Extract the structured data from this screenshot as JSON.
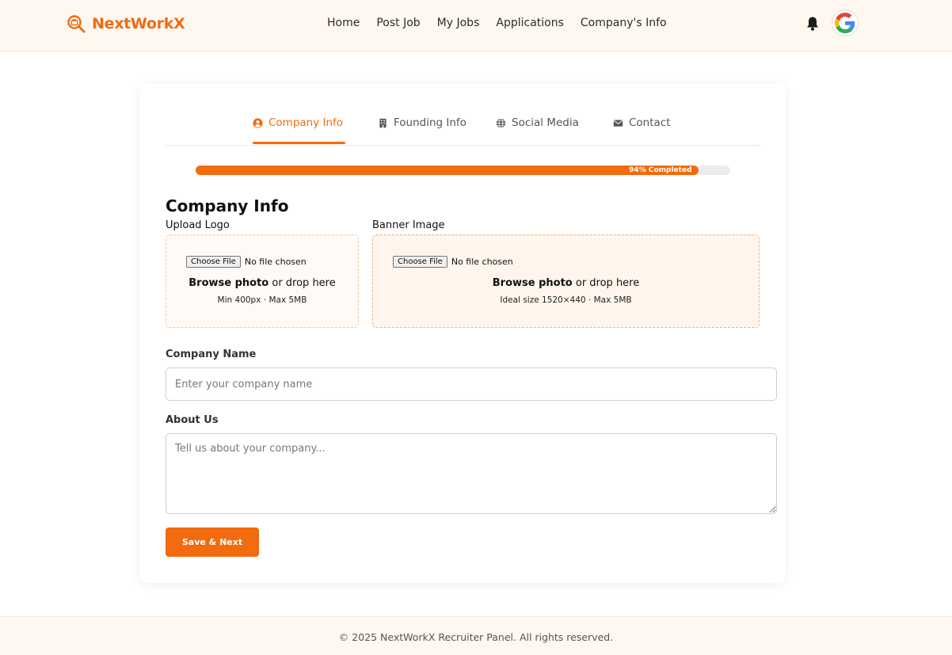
{
  "brand": {
    "name": "NextWorkX",
    "accent": "#f26b0f",
    "icon": "search-briefcase-icon"
  },
  "nav": {
    "items": [
      "Home",
      "Post Job",
      "My Jobs",
      "Applications",
      "Company's Info"
    ]
  },
  "header": {
    "bell_icon": "bell-icon",
    "avatar_icon": "google-g-icon"
  },
  "tabs": [
    {
      "label": "Company Info",
      "icon": "user-circle-icon",
      "active": true
    },
    {
      "label": "Founding Info",
      "icon": "building-icon",
      "active": false
    },
    {
      "label": "Social Media",
      "icon": "globe-icon",
      "active": false
    },
    {
      "label": "Contact",
      "icon": "envelope-icon",
      "active": false
    }
  ],
  "progress": {
    "percent": 94,
    "label": "94% Completed"
  },
  "form": {
    "section_title": "Company Info",
    "logo": {
      "label": "Upload Logo",
      "button": "Choose File",
      "status": "No file chosen",
      "browse_bold": "Browse photo",
      "browse_rest": " or drop here",
      "hint": "Min 400px · Max 5MB"
    },
    "banner": {
      "label": "Banner Image",
      "button": "Choose File",
      "status": "No file chosen",
      "browse_bold": "Browse photo",
      "browse_rest": " or drop here",
      "hint": "Ideal size 1520×440 · Max 5MB"
    },
    "company_name": {
      "label": "Company Name",
      "placeholder": "Enter your company name",
      "value": ""
    },
    "about": {
      "label": "About Us",
      "placeholder": "Tell us about your company...",
      "value": ""
    },
    "save_label": "Save & Next"
  },
  "footer": {
    "text": "© 2025 NextWorkX Recruiter Panel. All rights reserved."
  }
}
